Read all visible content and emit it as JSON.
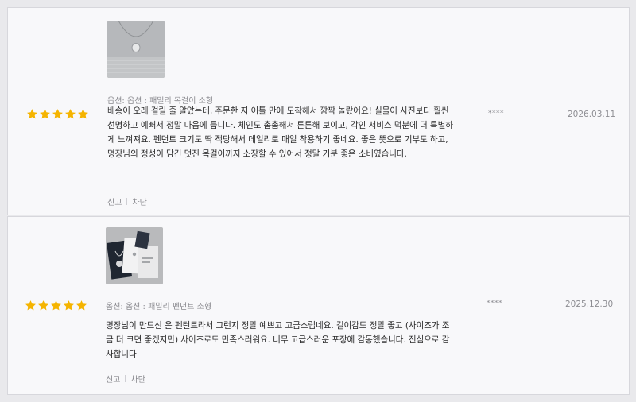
{
  "colors": {
    "star": "#f5b400",
    "card_bg": "#f8f8fa",
    "page_bg": "#e9e9ec"
  },
  "reviews": [
    {
      "photo_icon": "necklace-photo",
      "rating": 5,
      "option": "옵션: 옵션 : 패밀리 목걸이 소형",
      "text": "배송이 오래 걸릴 줄 알았는데, 주문한 지 이틀 만에 도착해서 깜짝 놀랐어요! 실물이 사진보다 훨씬 선명하고 예뻐서 정말 마음에 듭니다. 체인도 촘촘해서 튼튼해 보이고, 각인 서비스 덕분에 더 특별하게 느껴져요. 펜던트 크기도 딱 적당해서 데일리로 매일 착용하기 좋네요. 좋은 뜻으로 기부도 하고, 명장님의 정성이 담긴 멋진 목걸이까지 소장할 수 있어서 정말 기분 좋은 소비였습니다.",
      "actions": [
        "신고",
        "차단"
      ],
      "user": "****",
      "date": "2026.03.11"
    },
    {
      "photo_icon": "gift-box-photo",
      "rating": 5,
      "option": "옵션: 옵션 : 패밀리 펜던트 소형",
      "text": "명장님이 만드신 은 펜턴트라서 그런지 정말 예쁘고 고급스럽네요. 길이감도 정말 좋고 (사이즈가 조금 더 크면 좋겠지만) 사이즈로도 만족스러워요. 너무 고급스러운 포장에 감동했습니다. 진심으로 감사합니다",
      "actions": [
        "신고",
        "차단"
      ],
      "user": "****",
      "date": "2025.12.30"
    }
  ]
}
